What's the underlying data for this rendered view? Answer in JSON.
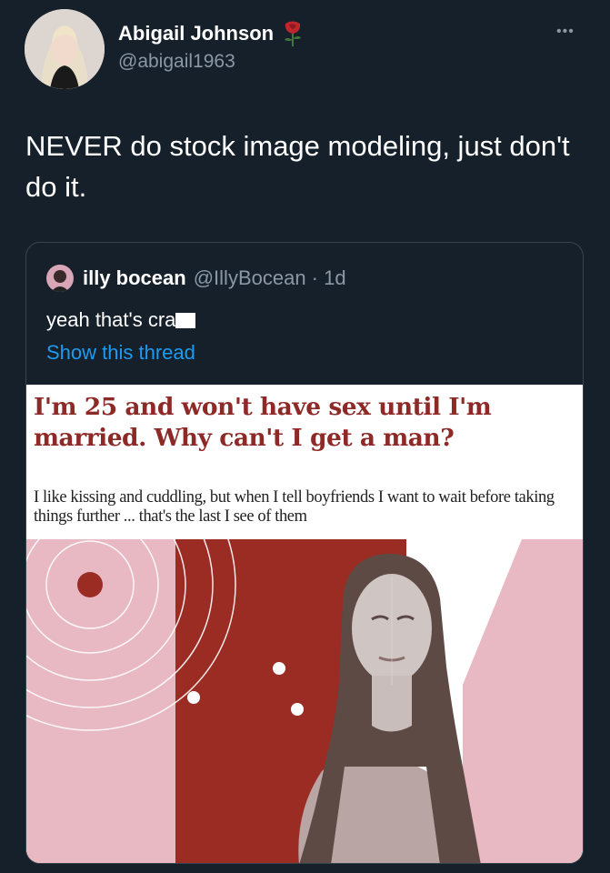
{
  "tweet": {
    "display_name": "Abigail Johnson",
    "handle": "@abigail1963",
    "text": "NEVER do stock image modeling, just don't do it.",
    "more_icon": "more-icon",
    "badge_icon": "rose-icon"
  },
  "quoted_tweet": {
    "display_name": "illy bocean",
    "handle_time": "@IllyBocean · 1d",
    "text": "yeah that's cra",
    "show_thread": "Show this thread"
  },
  "article": {
    "headline": "I'm 25 and won't have sex until I'm married. Why can't I get a man?",
    "standfirst": "I like kissing and cuddling, but when I tell boyfriends I want to wait before taking things further ... that's the last I see of them"
  },
  "colors": {
    "background": "#15202b",
    "headline": "#8d2a27",
    "link": "#1d9bf0",
    "pink": "#e8b8c3"
  }
}
